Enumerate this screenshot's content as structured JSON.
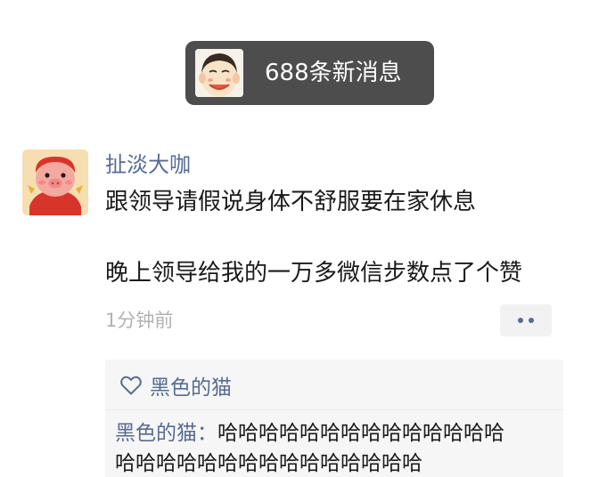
{
  "notice": {
    "text": "688条新消息",
    "avatar_icon": "cartoon-face-avatar"
  },
  "post": {
    "author": "扯淡大咖",
    "avatar_icon": "cartoon-pig-avatar",
    "lines": [
      "跟领导请假说身体不舒服要在家休息",
      "晚上领导给我的一万多微信步数点了个赞"
    ],
    "time": "1分钟前",
    "more_icon": "more-dots-icon"
  },
  "likes": {
    "icon": "heart-outline-icon",
    "users": [
      "黑色的猫"
    ]
  },
  "comments": [
    {
      "author": "黑色的猫",
      "separator": "：",
      "text_line1": "哈哈哈哈哈哈哈哈哈哈哈哈哈哈",
      "text_line2": "哈哈哈哈哈哈哈哈哈哈哈哈哈哈哈"
    }
  ],
  "colors": {
    "link": "#576b95",
    "notice_bg": "#4d4d4d",
    "panel_bg": "#f6f6f6",
    "meta": "#b2b2b2"
  }
}
